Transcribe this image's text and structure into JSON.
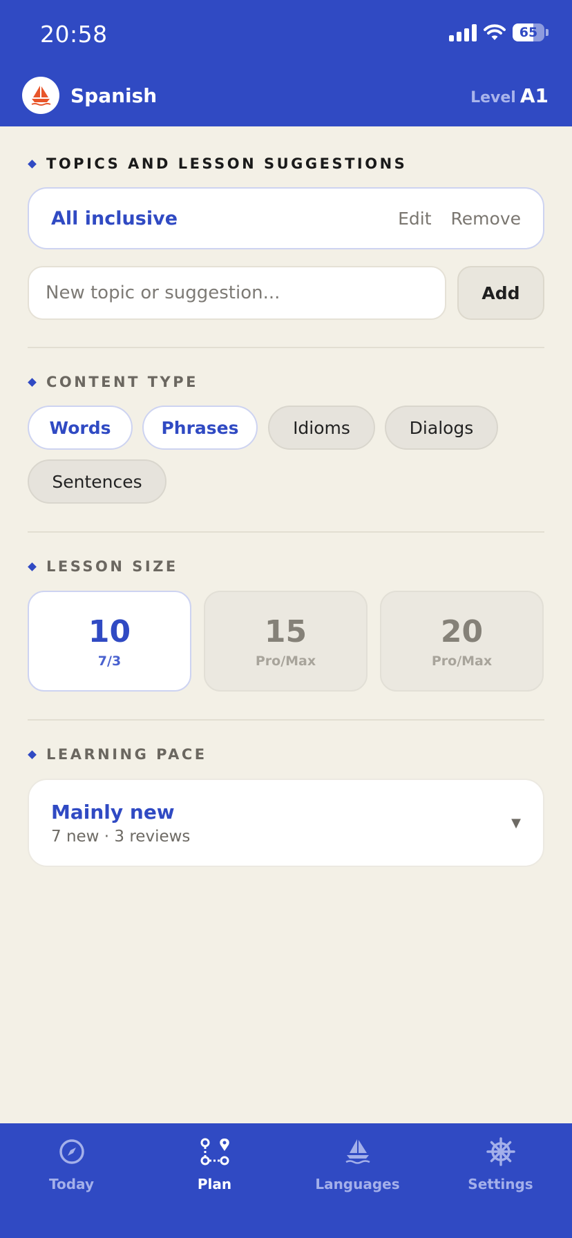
{
  "status": {
    "time": "20:58",
    "battery": "65",
    "battery_level": 0.65
  },
  "header": {
    "language": "Spanish",
    "level_label": "Level",
    "level_value": "A1"
  },
  "topics": {
    "title": "TOPICS AND LESSON SUGGESTIONS",
    "items": [
      {
        "name": "All inclusive",
        "edit": "Edit",
        "remove": "Remove"
      }
    ],
    "input_placeholder": "New topic or suggestion...",
    "add_label": "Add"
  },
  "content_type": {
    "title": "CONTENT TYPE",
    "options": [
      {
        "label": "Words",
        "selected": true
      },
      {
        "label": "Phrases",
        "selected": true
      },
      {
        "label": "Idioms",
        "selected": false
      },
      {
        "label": "Dialogs",
        "selected": false
      },
      {
        "label": "Sentences",
        "selected": false
      }
    ]
  },
  "lesson_size": {
    "title": "LESSON SIZE",
    "options": [
      {
        "value": "10",
        "sub": "7/3",
        "selected": true
      },
      {
        "value": "15",
        "sub": "Pro/Max",
        "selected": false
      },
      {
        "value": "20",
        "sub": "Pro/Max",
        "selected": false
      }
    ]
  },
  "learning_pace": {
    "title": "LEARNING PACE",
    "selected": "Mainly new",
    "detail": "7 new · 3 reviews"
  },
  "tabs": [
    {
      "label": "Today",
      "icon": "compass-icon",
      "active": false
    },
    {
      "label": "Plan",
      "icon": "route-icon",
      "active": true
    },
    {
      "label": "Languages",
      "icon": "sailboat-icon",
      "active": false
    },
    {
      "label": "Settings",
      "icon": "helm-icon",
      "active": false
    }
  ],
  "colors": {
    "primary": "#304AC3",
    "background": "#F3F0E6",
    "logo_accent": "#E8552A"
  }
}
